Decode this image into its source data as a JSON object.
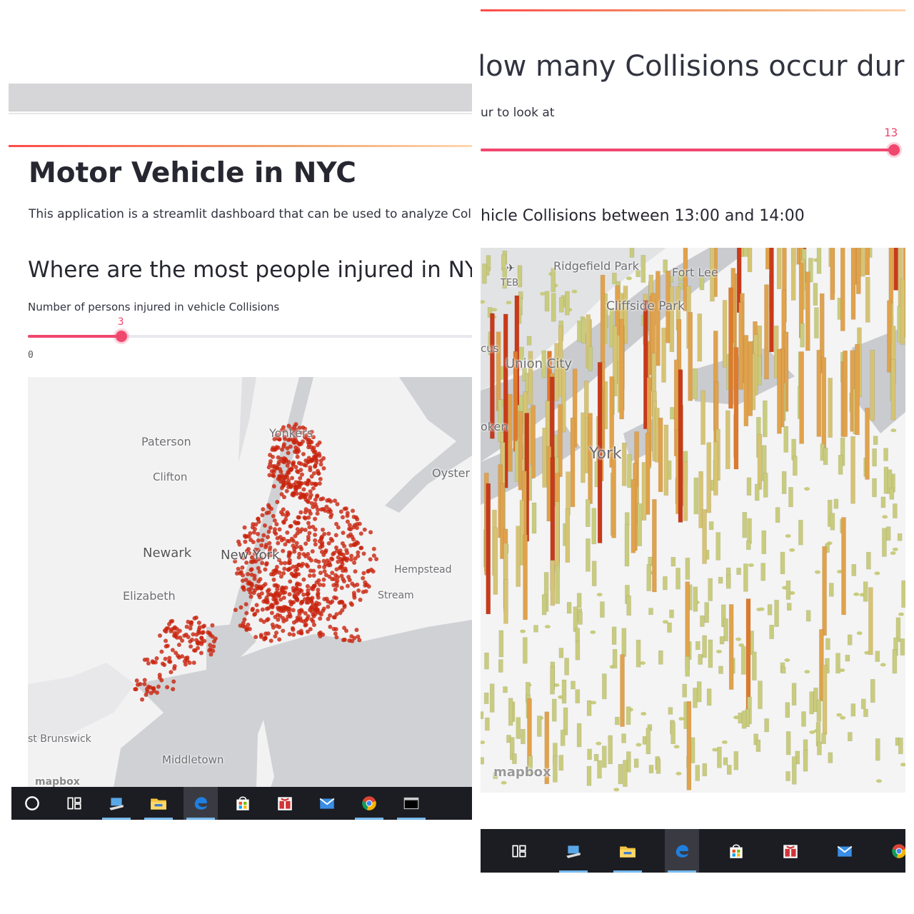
{
  "left": {
    "title": "Motor Vehicle in NYC",
    "description": "This application is a streamlit dashboard that can be used to analyze Coll",
    "subheader": "Where are the most people injured in NYC",
    "slider": {
      "label": "Number of persons injured in vehicle Collisions",
      "value": "3",
      "min_label": "0",
      "value_fraction": 0.21
    },
    "map_labels": {
      "paterson": "Paterson",
      "yonkers": "Yonkers",
      "clifton": "Clifton",
      "oyster": "Oyster",
      "newark": "Newark",
      "new_york": "New York",
      "hempstead": "Hempstead",
      "elizabeth": "Elizabeth",
      "stream": "Stream",
      "brunswick": "st Brunswick",
      "middletown": "Middletown",
      "mapbox": "mapbox"
    },
    "taskbar": [
      "cortana-icon",
      "task-view-icon",
      "network-icon",
      "file-explorer-icon",
      "edge-icon",
      "store-icon",
      "gift-icon",
      "mail-icon",
      "chrome-icon",
      "terminal-icon"
    ],
    "point_color": "#c8230c"
  },
  "right": {
    "subheader": "low many Collisions occur durin",
    "slider": {
      "label": "ur to look at",
      "value": "13",
      "value_fraction": 0.99
    },
    "caption": "hicle Collisions between 13:00 and 14:00",
    "map_labels": {
      "airport": "TEB",
      "ridgefield": "Ridgefield Park",
      "fort_lee": "Fort Lee",
      "cliffside": "Cliffside Park",
      "cus": "cus",
      "union_city": "Union City",
      "hoboken": "oken",
      "new_york": "York",
      "mapbox": "mapbox"
    },
    "taskbar": [
      "task-view-icon",
      "network-icon",
      "file-explorer-icon",
      "edge-icon",
      "store-icon",
      "gift-icon",
      "mail-icon",
      "chrome-icon"
    ],
    "column_colors": [
      "#c9cc7e",
      "#d6c474",
      "#e0a24c",
      "#df7a2c",
      "#c83a1a"
    ]
  },
  "accent": "#f0476e"
}
